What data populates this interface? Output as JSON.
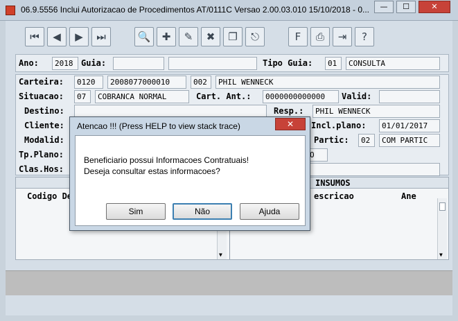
{
  "window": {
    "title": "06.9.5556   Inclui  Autorizacao de Procedimentos AT/0111C Versao 2.00.03.010 15/10/2018 - 0...",
    "minimize": "—",
    "maximize": "☐",
    "close": "✕"
  },
  "toolbar": {
    "buttons": [
      "first-icon",
      "previous-icon",
      "next-icon",
      "last-icon",
      "key-icon",
      "add-icon",
      "edit-icon",
      "delete-icon",
      "copy-icon",
      "exit-door-icon",
      "form-icon",
      "print-icon",
      "export-icon",
      "help-icon"
    ]
  },
  "header": {
    "ano_label": "Ano:",
    "ano_value": "2018",
    "guia_label": "Guia:",
    "guia_value": "",
    "guia_value2": "",
    "tipo_guia_label": "Tipo Guia:",
    "tipo_guia_code": "01",
    "tipo_guia_desc": "CONSULTA"
  },
  "form": {
    "carteira_label": "Carteira:",
    "carteira_1": "0120",
    "carteira_2": "2008077000010",
    "carteira_3": "002",
    "carteira_name": "PHIL WENNECK",
    "situacao_label": "Situacao:",
    "situacao_code": "07",
    "situacao_desc": "COBRANCA NORMAL",
    "cart_ant_label": "Cart. Ant.:",
    "cart_ant_value": "0000000000000",
    "valid_label": "Valid:",
    "valid_value": "",
    "destino_label": "Destino:",
    "resp_label": "Resp.:",
    "resp_value": "PHIL WENNECK",
    "cliente_label": "Cliente:",
    "incl_plano_label": "Incl.plano:",
    "incl_plano_value": "01/01/2017",
    "modalid_label": "Modalid:",
    "partic_label": "Partic:",
    "partic_code": "02",
    "partic_desc": "COM PARTIC",
    "tp_plano_label": "Tp.Plano:",
    "tp_plano_partial": "O",
    "clas_hos_label": "Clas.Hos:"
  },
  "section": {
    "insumos_title": "INSUMOS",
    "col_codigo": "Codigo De",
    "col_descricao": "escricao",
    "col_ane": "Ane"
  },
  "dialog": {
    "title": "Atencao !!!  (Press HELP to view stack trace)",
    "close": "✕",
    "message_line1": "Beneficiario possui Informacoes Contratuais!",
    "message_line2": "Deseja consultar estas informacoes?",
    "btn_sim": "Sim",
    "btn_nao": "Não",
    "btn_ajuda": "Ajuda"
  },
  "colors": {
    "accent_close": "#c74238",
    "dialog_frame": "#c9d7e5",
    "default_button_border": "#3c7fb1"
  }
}
